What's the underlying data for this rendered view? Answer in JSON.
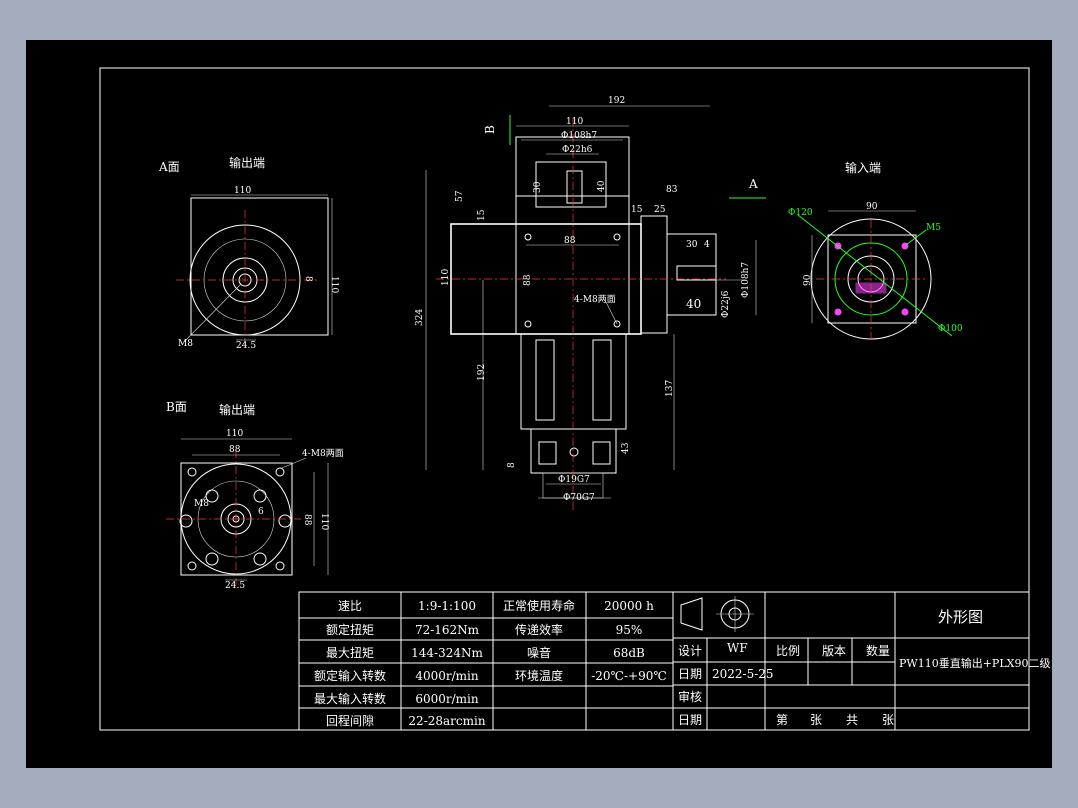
{
  "views": {
    "a_face": {
      "label": "A面",
      "title": "输出端"
    },
    "b_face": {
      "label": "B面",
      "title": "输出端"
    },
    "input_end": {
      "title": "输入端"
    }
  },
  "dims": {
    "a_110_top": "110",
    "a_110_side": "110",
    "a_m8": "M8",
    "a_245": "24.5",
    "a_8": "8",
    "b_110_top": "110",
    "b_88_top": "88",
    "b_4m8": "4-M8两面",
    "b_88_side": "88",
    "b_110_side": "110",
    "b_m8": "M8",
    "b_245": "24.5",
    "b_6": "6",
    "f_192_top": "192",
    "f_110": "110",
    "f_108h7": "Φ108h7",
    "f_22h6": "Φ22h6",
    "f_30": "30",
    "f_40": "40",
    "f_57": "57",
    "f_15a": "15",
    "f_83": "83",
    "f_15b": "15",
    "f_25": "25",
    "f_88a": "88",
    "f_88b": "88",
    "f_4m8": "4-M8两面",
    "f_110_side": "110",
    "f_324": "324",
    "f_192_side": "192",
    "f_137": "137",
    "f_30b": "30",
    "f_4": "4",
    "f_40b": "40",
    "f_108h7b": "Φ108h7",
    "f_226": "Φ22j6",
    "f_8": "8",
    "f_43": "43",
    "f_19g7": "Φ19G7",
    "f_70g7": "Φ70G7",
    "i_90_top": "90",
    "i_90_side": "90",
    "i_120": "Φ120",
    "i_m5": "M5",
    "i_100": "Φ100"
  },
  "markers": {
    "arrow_b": "B",
    "arrow_a": "A"
  },
  "specs": [
    {
      "k1": "速比",
      "v1": "1:9-1:100",
      "k2": "正常使用寿命",
      "v2": "20000 h"
    },
    {
      "k1": "额定扭矩",
      "v1": "72-162Nm",
      "k2": "传递效率",
      "v2": "95%"
    },
    {
      "k1": "最大扭矩",
      "v1": "144-324Nm",
      "k2": "噪音",
      "v2": "68dB"
    },
    {
      "k1": "额定输入转数",
      "v1": "4000r/min",
      "k2": "环境温度",
      "v2": "-20℃-+90℃"
    },
    {
      "k1": "最大输入转数",
      "v1": "6000r/min",
      "k2": "",
      "v2": ""
    },
    {
      "k1": "回程间隙",
      "v1": "22-28arcmin",
      "k2": "",
      "v2": ""
    }
  ],
  "title_block": {
    "drawing_name": "外形图",
    "model": "PW110垂直输出+PLX90二级",
    "design_label": "设计",
    "designer": "WF",
    "date_label": "日期",
    "date": "2022-5-25",
    "review_label": "审核",
    "date_label2": "日期",
    "scale_label": "比例",
    "version_label": "版本",
    "qty_label": "数量",
    "sheet_di": "第",
    "sheet_zhang": "张",
    "sheet_gong": "共",
    "sheet_zhang2": "张"
  }
}
